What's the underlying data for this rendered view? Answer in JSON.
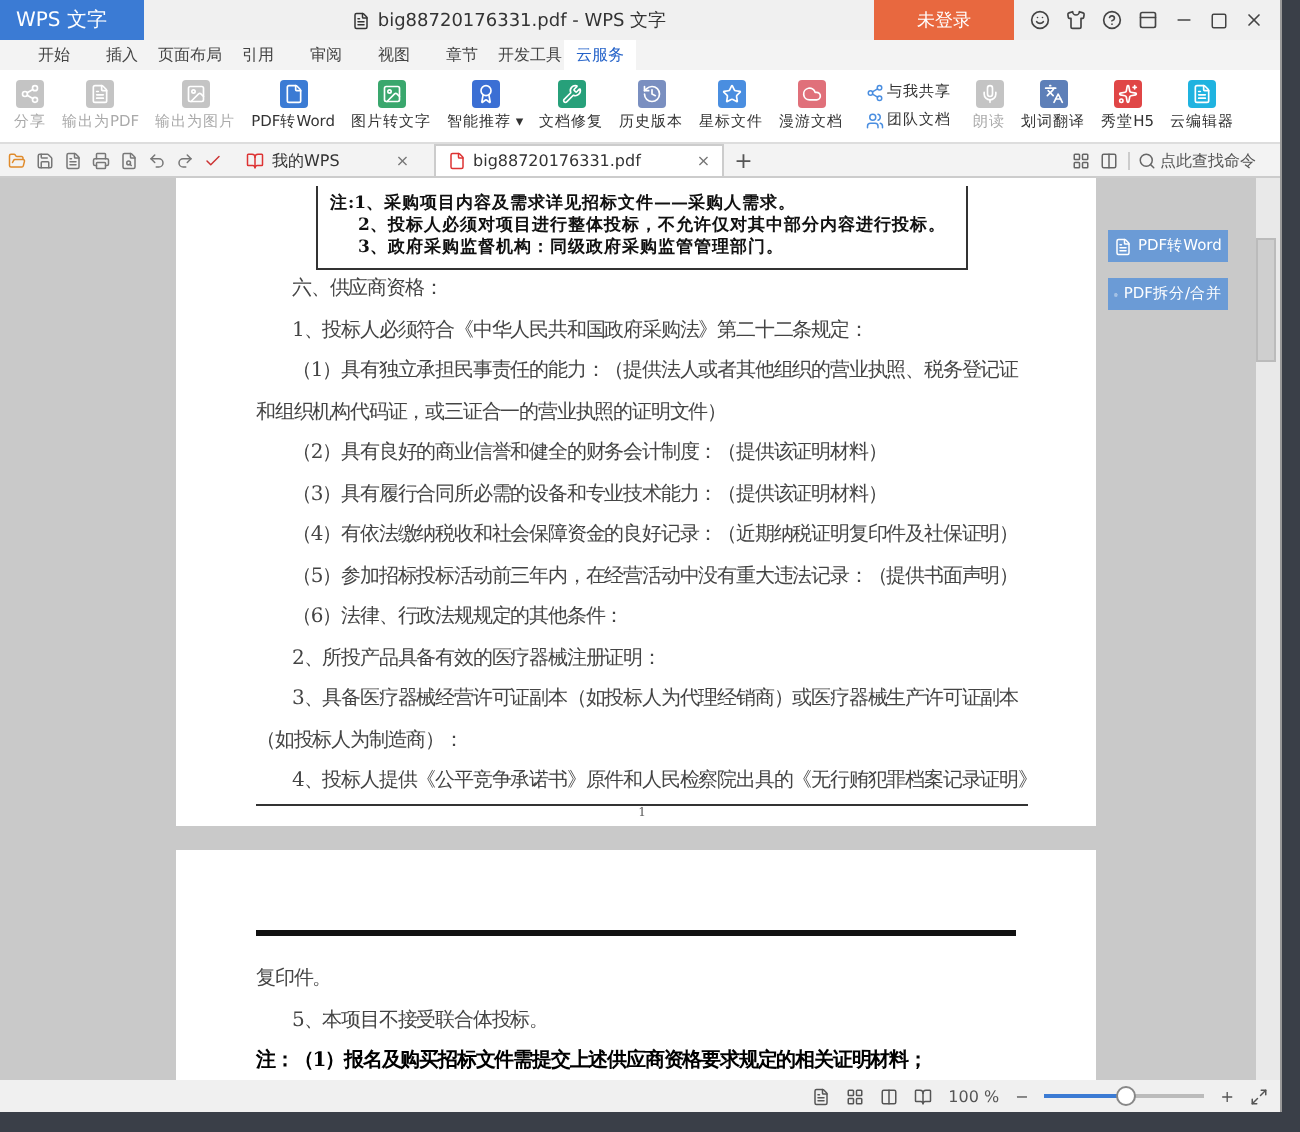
{
  "window": {
    "app_menu": "WPS 文字",
    "title": "big88720176331.pdf - WPS 文字",
    "login": "未登录"
  },
  "menu_tabs": [
    {
      "label": "开始",
      "selected": false
    },
    {
      "label": "插入",
      "selected": false
    },
    {
      "label": "页面布局",
      "selected": false
    },
    {
      "label": "引用",
      "selected": false
    },
    {
      "label": "审阅",
      "selected": false
    },
    {
      "label": "视图",
      "selected": false
    },
    {
      "label": "章节",
      "selected": false
    },
    {
      "label": "开发工具",
      "selected": false
    },
    {
      "label": "云服务",
      "selected": true
    }
  ],
  "ribbon": [
    {
      "kind": "large",
      "label": "分享",
      "disabled": true
    },
    {
      "kind": "large",
      "label": "输出为PDF",
      "disabled": true
    },
    {
      "kind": "large",
      "label": "输出为图片",
      "disabled": true
    },
    {
      "kind": "large",
      "label": "PDF转Word",
      "disabled": false
    },
    {
      "kind": "large",
      "label": "图片转文字",
      "disabled": false
    },
    {
      "kind": "large",
      "label": "智能推荐 ▾",
      "disabled": false
    },
    {
      "kind": "large",
      "label": "文档修复",
      "disabled": false
    },
    {
      "kind": "large",
      "label": "历史版本",
      "disabled": false
    },
    {
      "kind": "large",
      "label": "星标文件",
      "disabled": false
    },
    {
      "kind": "large",
      "label": "漫游文档",
      "disabled": false
    },
    {
      "kind": "stack",
      "labels": [
        "与我共享",
        "团队文档"
      ],
      "disabled": false
    },
    {
      "kind": "large",
      "label": "朗读",
      "disabled": true
    },
    {
      "kind": "large",
      "label": "划词翻译",
      "disabled": false
    },
    {
      "kind": "large",
      "label": "秀堂H5",
      "disabled": false
    },
    {
      "kind": "large",
      "label": "云编辑器",
      "disabled": false
    }
  ],
  "doc_tabs": [
    {
      "label": "我的WPS",
      "close": "×",
      "selected": false
    },
    {
      "label": "big88720176331.pdf",
      "close": "×",
      "selected": true
    }
  ],
  "new_tab": "+",
  "search": {
    "placeholder": "点此查找命令"
  },
  "side_buttons": [
    "PDF转Word",
    "PDF拆分/合并"
  ],
  "page1": {
    "notes": [
      "注:1、采购项目内容及需求详见招标文件——采购人需求。",
      "2、投标人必须对项目进行整体投标，不允许仅对其中部分内容进行投标。",
      "3、政府采购监督机构：同级政府采购监管管理部门。"
    ],
    "lines": [
      {
        "kind": "indent",
        "text": "六、供应商资格："
      },
      {
        "kind": "indent",
        "text": "1、投标人必须符合《中华人民共和国政府采购法》第二十二条规定："
      },
      {
        "kind": "indent",
        "text": "（1）具有独立承担民事责任的能力：（提供法人或者其他组织的营业执照、税务登记证"
      },
      {
        "kind": "flush",
        "text": "和组织机构代码证，或三证合一的营业执照的证明文件）"
      },
      {
        "kind": "indent",
        "text": "（2）具有良好的商业信誉和健全的财务会计制度：（提供该证明材料）"
      },
      {
        "kind": "indent",
        "text": "（3）具有履行合同所必需的设备和专业技术能力：（提供该证明材料）"
      },
      {
        "kind": "indent",
        "text": "（4）有依法缴纳税收和社会保障资金的良好记录：（近期纳税证明复印件及社保证明）"
      },
      {
        "kind": "indent",
        "text": "（5）参加招标投标活动前三年内，在经营活动中没有重大违法记录：（提供书面声明）"
      },
      {
        "kind": "indent",
        "text": "（6）法律、行政法规规定的其他条件："
      },
      {
        "kind": "indent",
        "text": "2、所投产品具备有效的医疗器械注册证明："
      },
      {
        "kind": "indent",
        "text": "3、具备医疗器械经营许可证副本（如投标人为代理经销商）或医疗器械生产许可证副本"
      },
      {
        "kind": "flush",
        "text": "（如投标人为制造商）："
      },
      {
        "kind": "indent",
        "text": "4、投标人提供《公平竞争承诺书》原件和人民检察院出具的《无行贿犯罪档案记录证明》"
      }
    ],
    "page_number": "1"
  },
  "page2": {
    "lines": [
      {
        "kind": "flush",
        "text": "复印件。"
      },
      {
        "kind": "indent",
        "text": "5、本项目不接受联合体投标。"
      },
      {
        "kind": "bold",
        "text": "注：（1）报名及购买招标文件需提交上述供应商资格要求规定的相关证明材料；"
      }
    ]
  },
  "status_bar": {
    "zoom": "100 %",
    "zoom_minus": "−",
    "zoom_plus": "+",
    "level": 0.5
  }
}
